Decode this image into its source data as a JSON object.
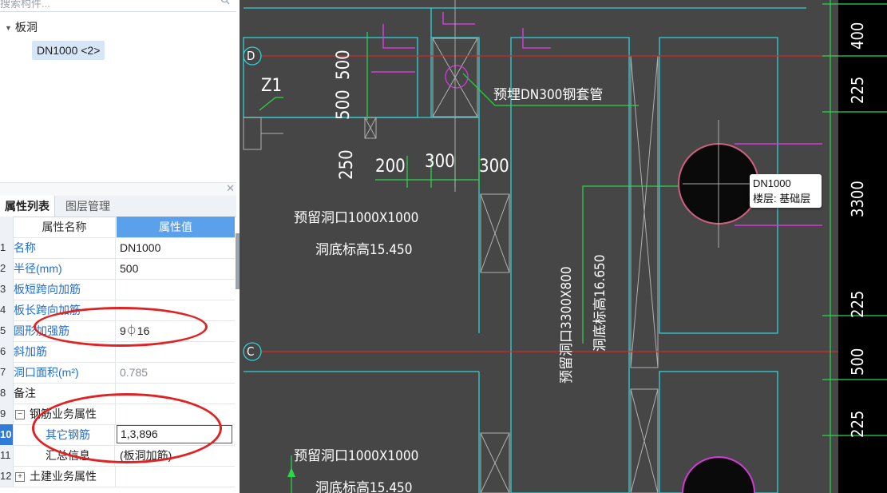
{
  "search": {
    "placeholder": "搜索构件..."
  },
  "tree": {
    "root_label": "板洞",
    "child_label": "DN1000 <2>"
  },
  "tabs": {
    "properties": "属性列表",
    "layers": "图层管理"
  },
  "grid": {
    "header": {
      "name": "属性名称",
      "value": "属性值"
    },
    "rows": [
      {
        "num": "1",
        "name": "名称",
        "value": "DN1000"
      },
      {
        "num": "2",
        "name": "半径(mm)",
        "value": "500"
      },
      {
        "num": "3",
        "name": "板短跨向加筋",
        "value": ""
      },
      {
        "num": "4",
        "name": "板长跨向加筋",
        "value": ""
      },
      {
        "num": "5",
        "name": "圆形加强筋",
        "value": "9⏀16"
      },
      {
        "num": "6",
        "name": "斜加筋",
        "value": ""
      },
      {
        "num": "7",
        "name": "洞口面积(m²)",
        "value": "0.785"
      },
      {
        "num": "8",
        "name": "备注",
        "value": ""
      },
      {
        "num": "9",
        "name": "钢筋业务属性",
        "value": ""
      },
      {
        "num": "10",
        "name": "其它钢筋",
        "value": "1,3,896"
      },
      {
        "num": "11",
        "name": "汇总信息",
        "value": "(板洞加筋)"
      },
      {
        "num": "12",
        "name": "土建业务属性",
        "value": ""
      }
    ]
  },
  "canvas": {
    "axis_d": "D",
    "axis_c": "C",
    "z1": "Z1",
    "dims_left": [
      "500",
      "500",
      "250",
      "200",
      "300",
      "300"
    ],
    "dims_right": [
      "400",
      "225",
      "3300",
      "225",
      "500",
      "225"
    ],
    "sleeve_label": "预埋DN300钢套管",
    "hole1_a": "预留洞口1000X1000",
    "hole1_b": "洞底标高15.450",
    "hole2_a": "预留洞口3300X800",
    "hole2_b": "洞底标高16.650",
    "hole3_a": "预留洞口1000X1000",
    "hole3_b": "洞底标高15.450"
  },
  "tooltip": {
    "line1": "DN1000",
    "line2": "楼层: 基础层"
  }
}
